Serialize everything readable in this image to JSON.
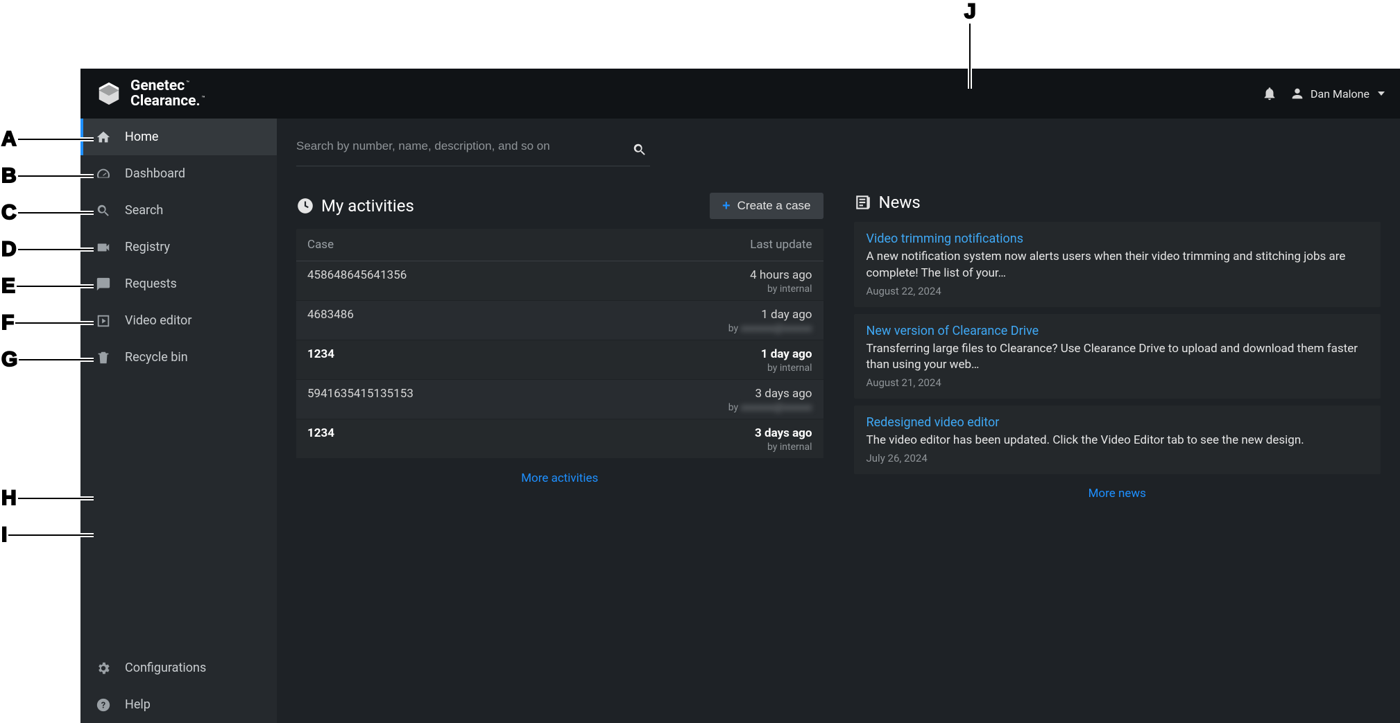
{
  "brand": {
    "line1": "Genetec",
    "line2": "Clearance."
  },
  "user": {
    "name": "Dan Malone"
  },
  "sidebar": {
    "items": [
      {
        "label": "Home",
        "icon": "home-icon",
        "active": true
      },
      {
        "label": "Dashboard",
        "icon": "gauge-icon"
      },
      {
        "label": "Search",
        "icon": "search-icon"
      },
      {
        "label": "Registry",
        "icon": "camera-icon"
      },
      {
        "label": "Requests",
        "icon": "chat-icon"
      },
      {
        "label": "Video editor",
        "icon": "play-box-icon"
      },
      {
        "label": "Recycle bin",
        "icon": "trash-icon"
      }
    ],
    "footer": [
      {
        "label": "Configurations",
        "icon": "gear-icon"
      },
      {
        "label": "Help",
        "icon": "help-icon"
      }
    ]
  },
  "search": {
    "placeholder": "Search by number, name, description, and so on"
  },
  "activities": {
    "title": "My activities",
    "create_label": "Create a case",
    "head_case": "Case",
    "head_update": "Last update",
    "more": "More activities",
    "rows": [
      {
        "case": "458648645641356",
        "time": "4 hours ago",
        "by": "by internal",
        "bold": false,
        "blurred": false
      },
      {
        "case": "4683486",
        "time": "1 day ago",
        "by": "by ",
        "bold": false,
        "blurred": true
      },
      {
        "case": "1234",
        "time": "1 day ago",
        "by": "by internal",
        "bold": true,
        "blurred": false
      },
      {
        "case": "5941635415135153",
        "time": "3 days ago",
        "by": "by ",
        "bold": false,
        "blurred": true
      },
      {
        "case": "1234",
        "time": "3 days ago",
        "by": "by internal",
        "bold": true,
        "blurred": false
      }
    ]
  },
  "news": {
    "title": "News",
    "more": "More news",
    "items": [
      {
        "title": "Video trimming notifications",
        "desc": "A new notification system now alerts users when their video trimming and stitching jobs are complete! The list of your…",
        "date": "August 22, 2024"
      },
      {
        "title": "New version of Clearance Drive",
        "desc": "Transferring large files to Clearance? Use Clearance Drive to upload and download them faster than using your web…",
        "date": "August 21, 2024"
      },
      {
        "title": "Redesigned video editor",
        "desc": "The video editor has been updated. Click the Video Editor tab to see the new design.",
        "date": "July 26, 2024"
      }
    ]
  },
  "callouts": {
    "A": "A",
    "B": "B",
    "C": "C",
    "D": "D",
    "E": "E",
    "F": "F",
    "G": "G",
    "H": "H",
    "I": "I",
    "J": "J"
  }
}
